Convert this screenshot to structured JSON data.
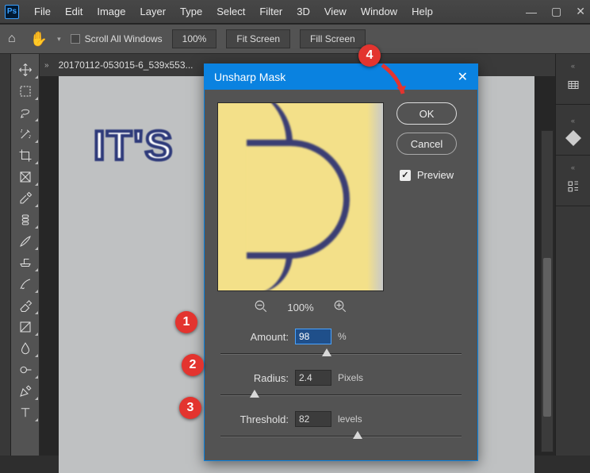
{
  "app_logo": "Ps",
  "menu": [
    "File",
    "Edit",
    "Image",
    "Layer",
    "Type",
    "Select",
    "Filter",
    "3D",
    "View",
    "Window",
    "Help"
  ],
  "optbar": {
    "scroll_all": "Scroll All Windows",
    "zoom": "100%",
    "fit": "Fit Screen",
    "fill": "Fill Screen"
  },
  "document_tab": "20170112-053015-6_539x553...",
  "canvas_text": "IT'S",
  "dialog": {
    "title": "Unsharp Mask",
    "ok": "OK",
    "cancel": "Cancel",
    "preview_label": "Preview",
    "preview_checked": true,
    "zoom": "100%",
    "amount": {
      "label": "Amount:",
      "value": "98",
      "unit": "%",
      "slider_pct": 44
    },
    "radius": {
      "label": "Radius:",
      "value": "2.4",
      "unit": "Pixels",
      "slider_pct": 14
    },
    "threshold": {
      "label": "Threshold:",
      "value": "82",
      "unit": "levels",
      "slider_pct": 57
    }
  },
  "annotations": {
    "1": "1",
    "2": "2",
    "3": "3",
    "4": "4"
  }
}
